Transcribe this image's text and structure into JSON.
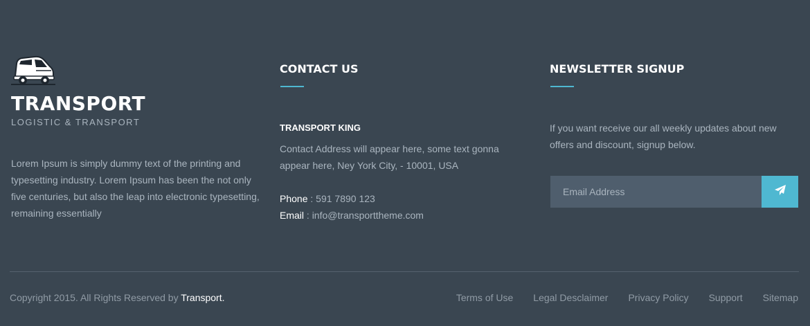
{
  "brand": {
    "name": "TRANSPORT",
    "tagline": "LOGISTIC & TRANSPORT",
    "description": "Lorem Ipsum is simply dummy text of the printing and typesetting industry. Lorem Ipsum has been the not only five centuries, but also the leap into electronic typesetting, remaining essentially",
    "icon": "truck-icon"
  },
  "contact": {
    "heading": "CONTACT US",
    "company": "TRANSPORT KING",
    "address": "Contact Address will appear here, some text gonna appear here, Ney York City, - 10001, USA",
    "phone_label": "Phone",
    "phone_value": "591 7890 123",
    "email_label": "Email",
    "email_value": "info@transporttheme.com"
  },
  "newsletter": {
    "heading": "NEWSLETTER SIGNUP",
    "text": "If you want receive our all weekly updates about new offers and discount, signup below.",
    "placeholder": "Email Address",
    "submit_icon": "paper-plane-icon"
  },
  "footer": {
    "copyright_prefix": "Copyright 2015. All Rights Reserved by ",
    "copyright_brand": "Transport.",
    "links": [
      "Terms of Use",
      "Legal Desclaimer",
      "Privacy Policy",
      "Support",
      "Sitemap"
    ]
  },
  "colors": {
    "background": "#3a4651",
    "accent": "#4fb8d1",
    "input_background": "#4f5e6d"
  }
}
